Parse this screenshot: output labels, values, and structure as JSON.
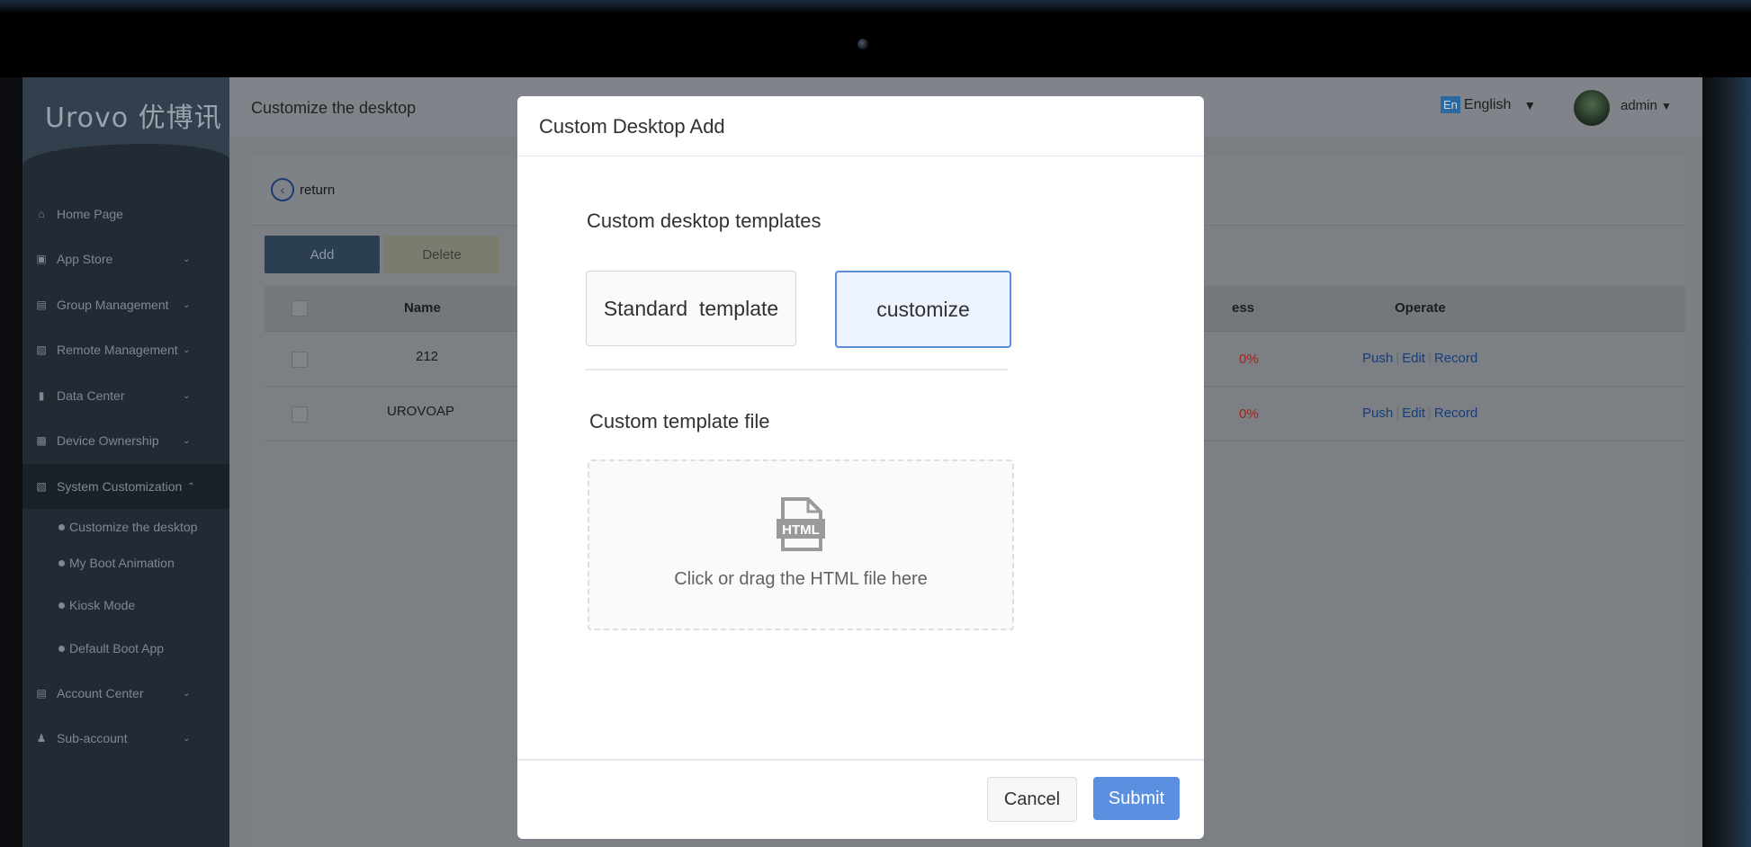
{
  "app": {
    "logo_text": "Urovo 优博讯",
    "page_title": "Customize the desktop",
    "language": "English",
    "language_badge": "En",
    "user": "admin"
  },
  "sidebar": {
    "items": [
      {
        "label": "Home Page",
        "icon": "home-icon"
      },
      {
        "label": "App Store",
        "icon": "store-icon"
      },
      {
        "label": "Group Management",
        "icon": "group-icon"
      },
      {
        "label": "Remote Management",
        "icon": "monitor-icon"
      },
      {
        "label": "Data Center",
        "icon": "bar-chart-icon"
      },
      {
        "label": "Device Ownership",
        "icon": "device-icon"
      },
      {
        "label": "System Customization",
        "icon": "monitor-icon"
      },
      {
        "label": "Account Center",
        "icon": "id-card-icon"
      },
      {
        "label": "Sub-account",
        "icon": "users-icon"
      }
    ],
    "sub_items": [
      {
        "label": "Customize the desktop"
      },
      {
        "label": "My Boot Animation"
      },
      {
        "label": "Kiosk Mode"
      },
      {
        "label": "Default Boot App"
      }
    ]
  },
  "toolbar": {
    "return_label": "return",
    "add_label": "Add",
    "delete_label": "Delete"
  },
  "table": {
    "columns": {
      "name": "Name",
      "progress_partial": "ess",
      "operate": "Operate"
    },
    "rows": [
      {
        "name": "212",
        "progress": "0%",
        "push": "Push",
        "edit": "Edit",
        "record": "Record"
      },
      {
        "name": "UROVOAP",
        "progress": "0%",
        "push": "Push",
        "edit": "Edit",
        "record": "Record"
      }
    ]
  },
  "modal": {
    "title": "Custom Desktop Add",
    "templates_label": "Custom desktop templates",
    "standard_template": "Standard  template",
    "customize": "customize",
    "file_label": "Custom template file",
    "file_icon_text": "HTML",
    "drop_text": "Click or drag the HTML file here",
    "cancel_label": "Cancel",
    "submit_label": "Submit"
  },
  "colors": {
    "accent": "#5b8fe0",
    "selected_bg": "#ecf3ff",
    "sidebar_bg": "#222a33",
    "link": "#173d78",
    "progress_red": "#a2261a"
  }
}
